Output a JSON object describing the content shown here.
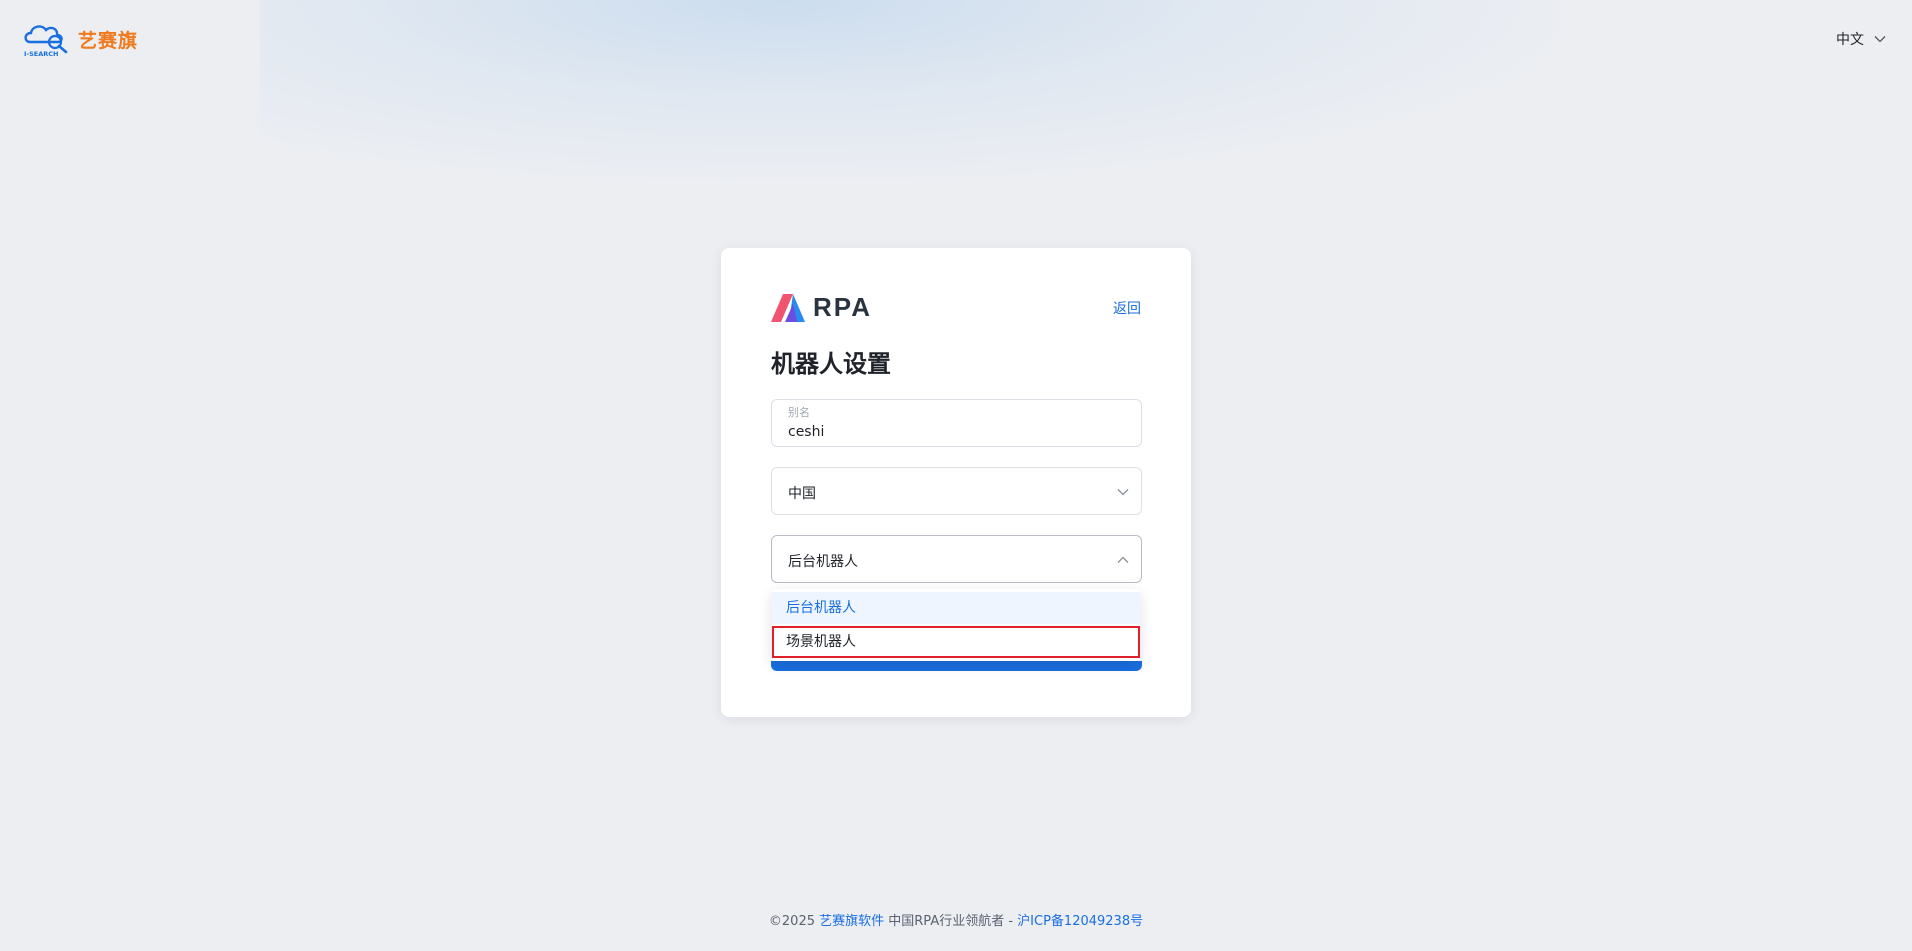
{
  "brand": {
    "name": "艺赛旗",
    "mark_text": "I-SEARCH"
  },
  "lang": {
    "label": "中文"
  },
  "card": {
    "logo_text": "RPA",
    "back_label": "返回",
    "title": "机器人设置",
    "alias": {
      "label": "别名",
      "value": "ceshi"
    },
    "region": {
      "value": "中国"
    },
    "type": {
      "value": "后台机器人",
      "options": [
        "后台机器人",
        "场景机器人"
      ]
    }
  },
  "footer": {
    "copyright": "©2025 ",
    "company_link": "艺赛旗软件",
    "slogan": " 中国RPA行业领航者 - ",
    "icp_link": "沪ICP备12049238号"
  },
  "colors": {
    "accent": "#1a6fe0",
    "brand": "#f07a1e",
    "highlight": "#e0212b"
  }
}
